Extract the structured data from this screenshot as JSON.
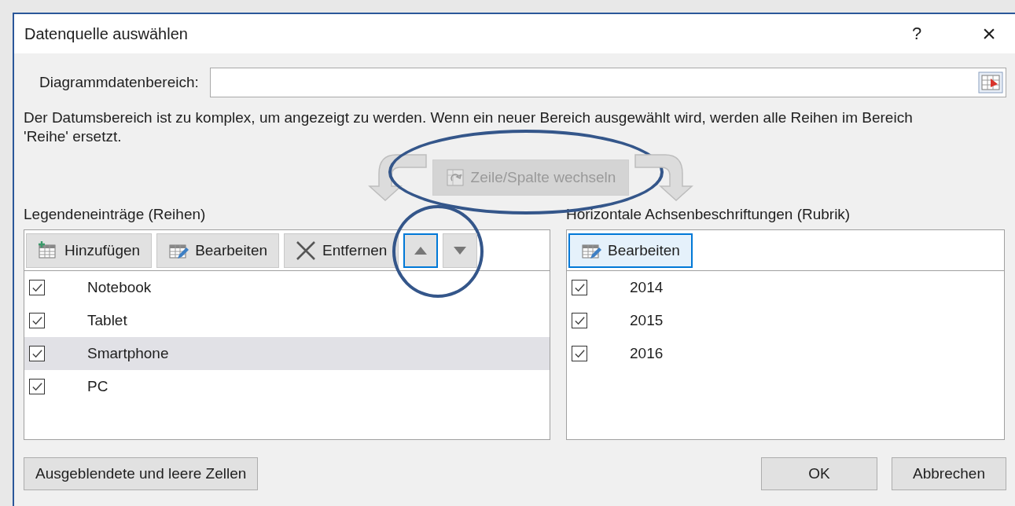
{
  "window": {
    "title": "Datenquelle auswählen",
    "help": "?",
    "close": "×"
  },
  "range": {
    "label": "Diagrammdatenbereich:"
  },
  "message": "Der Datumsbereich ist zu komplex, um angezeigt zu werden. Wenn ein neuer Bereich ausgewählt wird, werden alle Reihen im Bereich 'Reihe' ersetzt.",
  "swap_button": {
    "label": "Zeile/Spalte wechseln",
    "disabled": true,
    "highlighted": true
  },
  "series_panel": {
    "title": "Legendeneinträge (Reihen)",
    "toolbar": [
      {
        "kind": "add",
        "label": "Hinzufügen",
        "focused": false,
        "highlighted": false
      },
      {
        "kind": "edit",
        "label": "Bearbeiten",
        "focused": false,
        "highlighted": false
      },
      {
        "kind": "remove",
        "label": "Entfernen",
        "focused": false,
        "highlighted": false
      },
      {
        "kind": "up",
        "focused": true,
        "highlighted": true
      },
      {
        "kind": "down",
        "focused": false,
        "highlighted": false
      }
    ],
    "items": [
      {
        "label": "Notebook",
        "checked": true,
        "selected": false
      },
      {
        "label": "Tablet",
        "checked": true,
        "selected": false
      },
      {
        "label": "Smartphone",
        "checked": true,
        "selected": true
      },
      {
        "label": "PC",
        "checked": true,
        "selected": false
      }
    ]
  },
  "category_panel": {
    "title": "Horizontale Achsenbeschriftungen (Rubrik)",
    "toolbar": [
      {
        "kind": "edit",
        "label": "Bearbeiten",
        "focused": true,
        "highlighted": false
      }
    ],
    "items": [
      {
        "label": "2014",
        "checked": true,
        "selected": false
      },
      {
        "label": "2015",
        "checked": true,
        "selected": false
      },
      {
        "label": "2016",
        "checked": true,
        "selected": false
      }
    ]
  },
  "footer": {
    "hidden_cells_button": "Ausgeblendete und leere Zellen",
    "ok_button": "OK",
    "cancel_button": "Abbrechen"
  }
}
